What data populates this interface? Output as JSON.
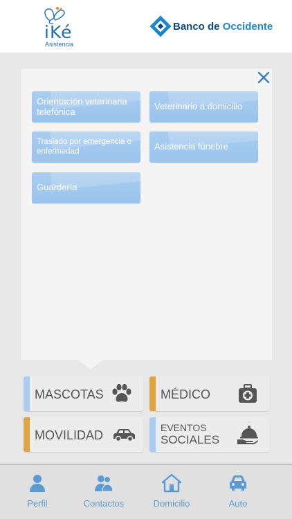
{
  "header": {
    "ike_logo_word": "iKé",
    "ike_logo_sub": "Asistencia",
    "bank_name_part1": "Banco de ",
    "bank_name_part2": "Occidente"
  },
  "panel": {
    "services": [
      {
        "label": "Orientación veterinaria telefónica"
      },
      {
        "label": "Veterinario a domicilio"
      },
      {
        "label": "Traslado por emergencia o enfermedad"
      },
      {
        "label": "Asistencia fúnebre"
      },
      {
        "label": "Guardería"
      }
    ]
  },
  "categories": [
    {
      "label": "MASCOTAS",
      "icon": "paw-icon",
      "color": "#a9cdf0"
    },
    {
      "label": "MÉDICO",
      "icon": "medical-kit-icon",
      "color": "#e0a540"
    },
    {
      "label": "MOVILIDAD",
      "icon": "car-icon",
      "color": "#e0a540"
    },
    {
      "label_line1": "EVENTOS",
      "label_line2": "SOCIALES",
      "icon": "serving-tray-icon",
      "color": "#a9cdf0"
    }
  ],
  "navbar": {
    "items": [
      {
        "label": "Perfil",
        "icon": "person-icon"
      },
      {
        "label": "Contactos",
        "icon": "contacts-icon"
      },
      {
        "label": "Domicilio",
        "icon": "house-icon"
      },
      {
        "label": "Auto",
        "icon": "car-icon"
      }
    ]
  },
  "colors": {
    "accent_blue": "#5a9bd6",
    "service_blue": "#a9cdf0",
    "category_orange": "#e0a540",
    "bank_navy": "#0b4a7c"
  }
}
